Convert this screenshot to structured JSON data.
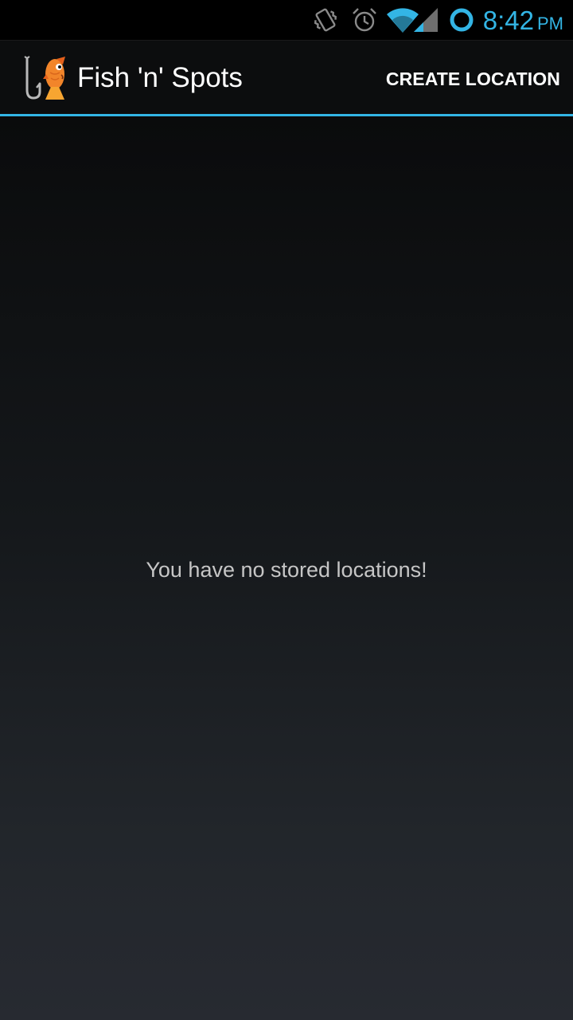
{
  "status_bar": {
    "time": "8:42",
    "ampm": "PM",
    "accent_color": "#33b5e5",
    "icons": [
      "vibrate-icon",
      "alarm-icon",
      "wifi-icon",
      "cell-signal-icon",
      "sync-icon"
    ]
  },
  "action_bar": {
    "logo": "fish-hook-logo-icon",
    "title": "Fish 'n' Spots",
    "create_location_label": "CREATE LOCATION",
    "divider_color": "#33b5e5"
  },
  "content": {
    "empty_message": "You have no stored locations!"
  }
}
